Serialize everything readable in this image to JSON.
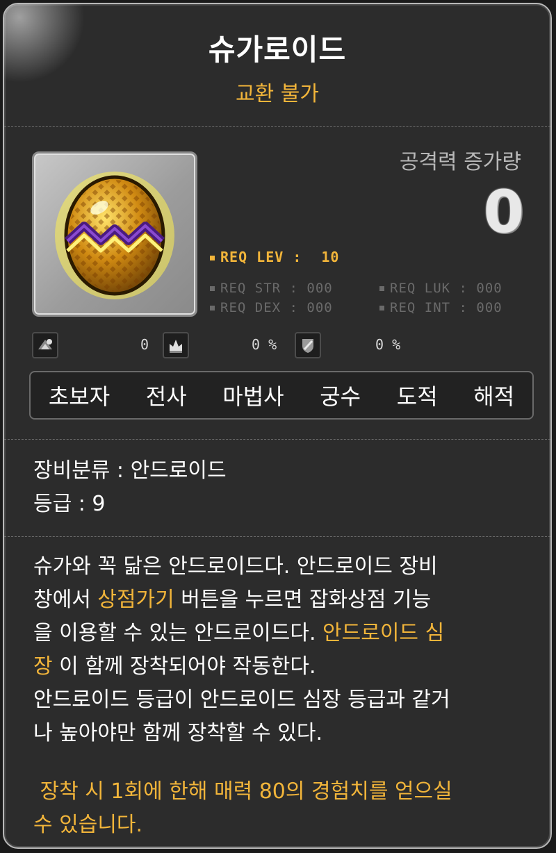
{
  "item": {
    "name": "슈가로이드",
    "trade": "교환 불가"
  },
  "attack": {
    "label": "공격력 증가량",
    "value": "0"
  },
  "requirements": {
    "lev_label": "REQ LEV :",
    "lev_value": "10",
    "str": "REQ STR : 000",
    "luk": "REQ LUK : 000",
    "dex": "REQ DEX : 000",
    "int": "REQ INT : 000"
  },
  "stats": [
    {
      "icon": "boss-damage-icon",
      "value": "0"
    },
    {
      "icon": "crown-icon",
      "value": "0 %"
    },
    {
      "icon": "shield-pierce-icon",
      "value": "0 %"
    }
  ],
  "jobs": [
    "초보자",
    "전사",
    "마법사",
    "궁수",
    "도적",
    "해적"
  ],
  "info": {
    "category": "장비분류 : 안드로이드",
    "grade": "등급 : 9"
  },
  "description": {
    "p1": "슈가와 꼭 닮은 안드로이드다. 안드로이드 장비",
    "p2a": "창에서 ",
    "p2hl": "상점가기",
    "p2b": " 버튼을 누르면 잡화상점 기능",
    "p3a": "을 이용할 수 있는 안드로이드다. ",
    "p3hl": "안드로이드 심",
    "p4hl": "장",
    "p4b": " 이 함께 장착되어야 작동한다.",
    "p5": "안드로이드 등급이 안드로이드 심장 등급과 같거",
    "p6": "나 높아야만 함께 장착할 수 있다."
  },
  "note": {
    "line1": " 장착 시 1회에 한해 매력 80의 경험치를 얻으실",
    "line2": "수 있습니다."
  },
  "colors": {
    "gold": "#f2b53a",
    "background": "#2c2c2c",
    "border": "#b8b8b8"
  }
}
